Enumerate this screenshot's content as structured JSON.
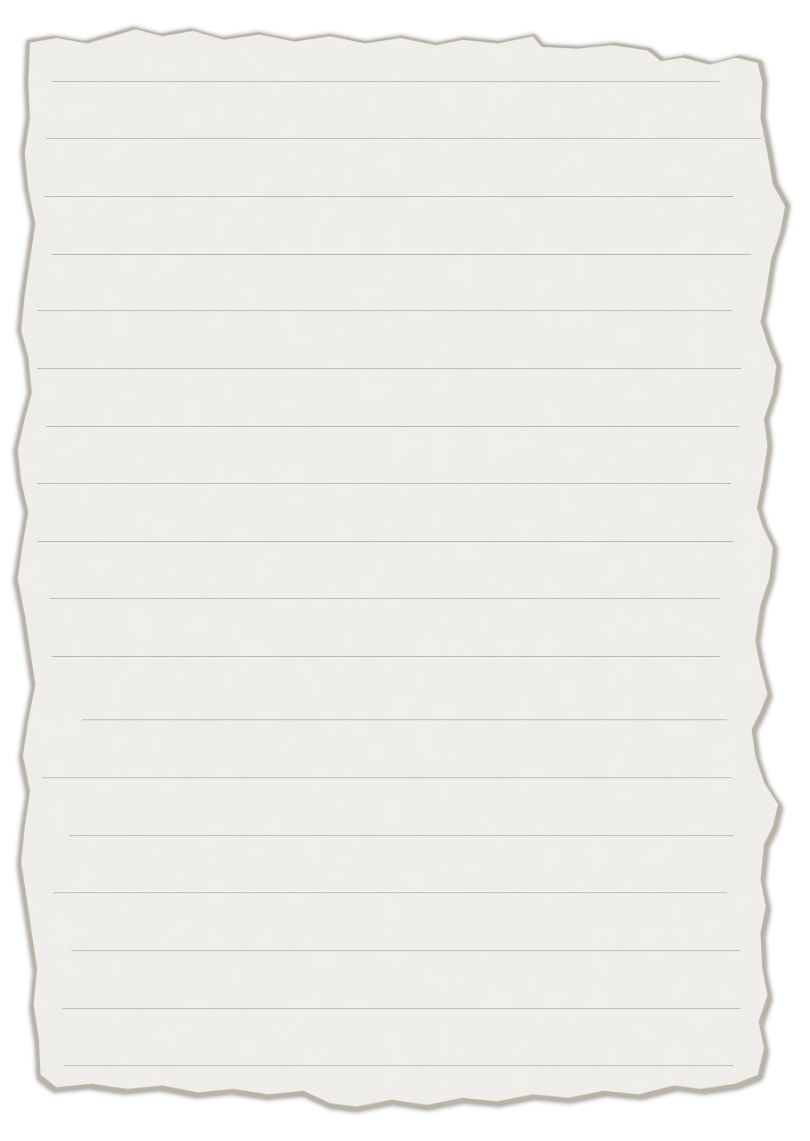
{
  "paper": {
    "style": "torn ruled notebook sheet",
    "paper_color": "#f1f0ec",
    "edge_shadow_color": "#b9b2a6",
    "rule_color": "#b7b7b3",
    "ruled_line_count": 18,
    "text_content": ""
  }
}
